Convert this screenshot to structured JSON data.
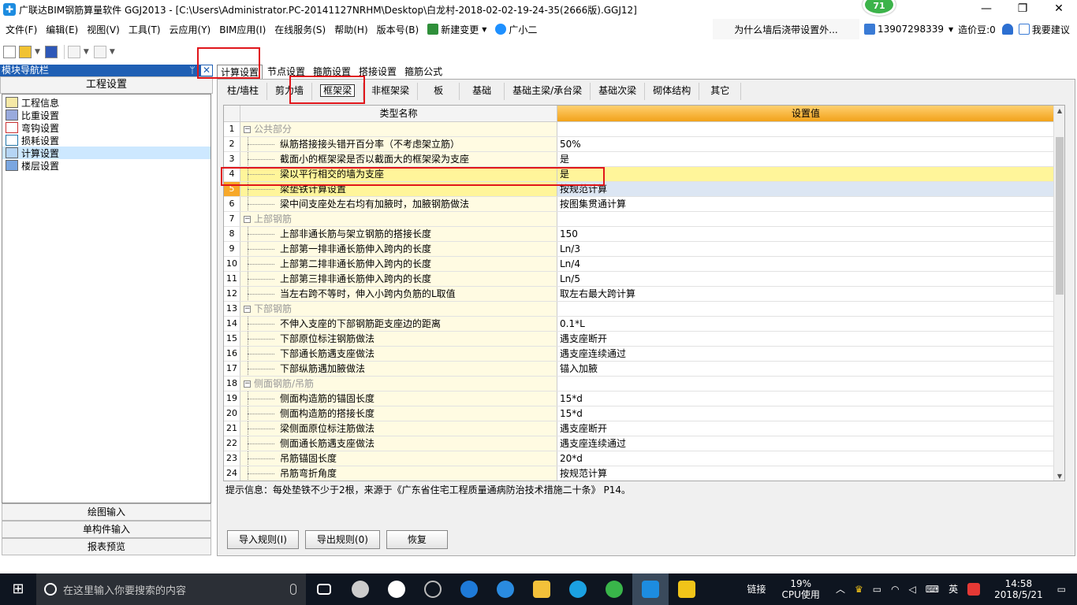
{
  "window": {
    "title": "广联达BIM钢筋算量软件 GGJ2013 - [C:\\Users\\Administrator.PC-20141127NRHM\\Desktop\\白龙村-2018-02-02-19-24-35(2666版).GGJ12]",
    "badge": "71",
    "minimize": "—",
    "restore": "❐",
    "close": "✕"
  },
  "menu": {
    "items": [
      "文件(F)",
      "编辑(E)",
      "视图(V)",
      "工具(T)",
      "云应用(Y)",
      "BIM应用(I)",
      "在线服务(S)",
      "帮助(H)",
      "版本号(B)"
    ],
    "new_change": "新建变更",
    "assistant": "广小二",
    "news": "为什么墙后浇带设置外...",
    "phone": "13907298339",
    "beans": "造价豆:0",
    "suggest": "我要建议"
  },
  "left_panel": {
    "header": "模块导航栏",
    "pin": "ᛘ",
    "close": "✕",
    "section": "工程设置",
    "items": [
      "工程信息",
      "比重设置",
      "弯钩设置",
      "损耗设置",
      "计算设置",
      "楼层设置"
    ],
    "bottom": [
      "绘图输入",
      "单构件输入",
      "报表预览"
    ]
  },
  "tabs": [
    "计算设置",
    "节点设置",
    "箍筋设置",
    "搭接设置",
    "箍筋公式"
  ],
  "subtabs": [
    "柱/墙柱",
    "剪力墙",
    "框架梁",
    "非框架梁",
    "板",
    "基础",
    "基础主梁/承台梁",
    "基础次梁",
    "砌体结构",
    "其它"
  ],
  "grid": {
    "col_name": "类型名称",
    "col_value": "设置值",
    "rows": [
      {
        "n": "1",
        "name": "公共部分",
        "value": "",
        "group": true
      },
      {
        "n": "2",
        "name": "纵筋搭接接头错开百分率（不考虑架立筋）",
        "value": "50%"
      },
      {
        "n": "3",
        "name": "截面小的框架梁是否以截面大的框架梁为支座",
        "value": "是"
      },
      {
        "n": "4",
        "name": "梁以平行相交的墙为支座",
        "value": "是",
        "selected": true
      },
      {
        "n": "5",
        "name": "梁垫铁计算设置",
        "value": "按规范计算",
        "highlight": true
      },
      {
        "n": "6",
        "name": "梁中间支座处左右均有加腋时，加腋钢筋做法",
        "value": "按图集贯通计算"
      },
      {
        "n": "7",
        "name": "上部钢筋",
        "value": "",
        "group": true
      },
      {
        "n": "8",
        "name": "上部非通长筋与架立钢筋的搭接长度",
        "value": "150"
      },
      {
        "n": "9",
        "name": "上部第一排非通长筋伸入跨内的长度",
        "value": "Ln/3"
      },
      {
        "n": "10",
        "name": "上部第二排非通长筋伸入跨内的长度",
        "value": "Ln/4"
      },
      {
        "n": "11",
        "name": "上部第三排非通长筋伸入跨内的长度",
        "value": "Ln/5"
      },
      {
        "n": "12",
        "name": "当左右跨不等时，伸入小跨内负筋的L取值",
        "value": "取左右最大跨计算"
      },
      {
        "n": "13",
        "name": "下部钢筋",
        "value": "",
        "group": true
      },
      {
        "n": "14",
        "name": "不伸入支座的下部钢筋距支座边的距离",
        "value": "0.1*L"
      },
      {
        "n": "15",
        "name": "下部原位标注钢筋做法",
        "value": "遇支座断开"
      },
      {
        "n": "16",
        "name": "下部通长筋遇支座做法",
        "value": "遇支座连续通过"
      },
      {
        "n": "17",
        "name": "下部纵筋遇加腋做法",
        "value": "锚入加腋"
      },
      {
        "n": "18",
        "name": "侧面钢筋/吊筋",
        "value": "",
        "group": true
      },
      {
        "n": "19",
        "name": "侧面构造筋的锚固长度",
        "value": "15*d"
      },
      {
        "n": "20",
        "name": "侧面构造筋的搭接长度",
        "value": "15*d"
      },
      {
        "n": "21",
        "name": "梁侧面原位标注筋做法",
        "value": "遇支座断开"
      },
      {
        "n": "22",
        "name": "侧面通长筋遇支座做法",
        "value": "遇支座连续通过"
      },
      {
        "n": "23",
        "name": "吊筋锚固长度",
        "value": "20*d"
      },
      {
        "n": "24",
        "name": "吊筋弯折角度",
        "value": "按规范计算"
      }
    ]
  },
  "hint": "提示信息：每处垫铁不少于2根，来源于《广东省住宅工程质量通病防治技术措施二十条》 P14。",
  "buttons": {
    "import": "导入规则(I)",
    "export": "导出规则(0)",
    "restore": "恢复"
  },
  "taskbar": {
    "search_placeholder": "在这里输入你要搜索的内容",
    "link": "链接",
    "cpu_pct": "19%",
    "cpu_label": "CPU使用",
    "ime": "英",
    "time": "14:58",
    "date": "2018/5/21"
  }
}
